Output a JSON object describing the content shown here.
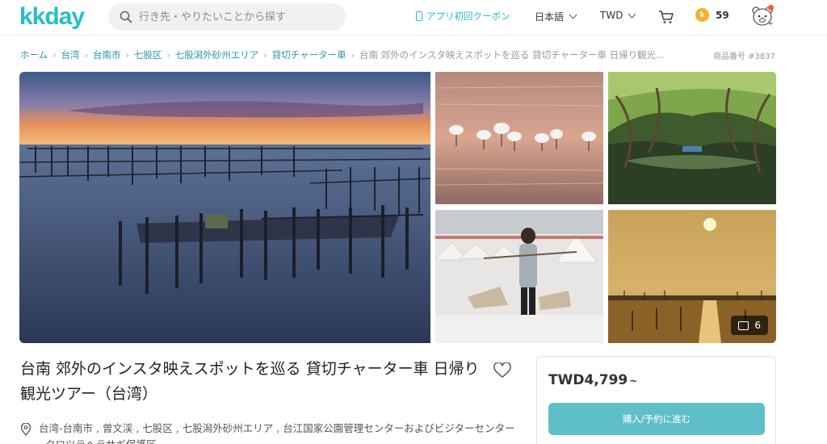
{
  "header": {
    "logo_text": "kkday",
    "search_placeholder": "行き先・やりたいことから探す",
    "coupon_label": "アプリ初回クーポン",
    "language": "日本語",
    "currency": "TWD",
    "points": "59",
    "coin_letter": "k"
  },
  "breadcrumb": {
    "items": [
      "ホーム",
      "台湾",
      "台南市",
      "七股区",
      "七股潟外砂州エリア",
      "貸切チャーター車"
    ],
    "current": "台南 郊外のインスタ映えスポットを巡る 貸切チャーター車 日帰り観光...",
    "product_no": "商品番号 #3837"
  },
  "gallery": {
    "photo_count": "6",
    "photos": [
      "oyster-farm-sunset",
      "spoonbills-in-water",
      "green-tunnel-boat",
      "salt-field-woman",
      "sunset-over-water"
    ]
  },
  "product": {
    "title": "台南 郊外のインスタ映えスポットを巡る 貸切チャーター車 日帰り観光ツアー（台湾）",
    "location": "台湾-台南市 , 曾文渓 , 七股区 , 七股潟外砂州エリア , 台江国家公園管理センターおよびビジターセンター , クロツラヘラサギ保護区"
  },
  "price_card": {
    "price": "TWD4,799",
    "price_suffix": "~",
    "button_label": "購入/予約に進む"
  },
  "colors": {
    "brand": "#26bec9",
    "button": "#5fbfc9",
    "coin": "#f3b32a"
  }
}
